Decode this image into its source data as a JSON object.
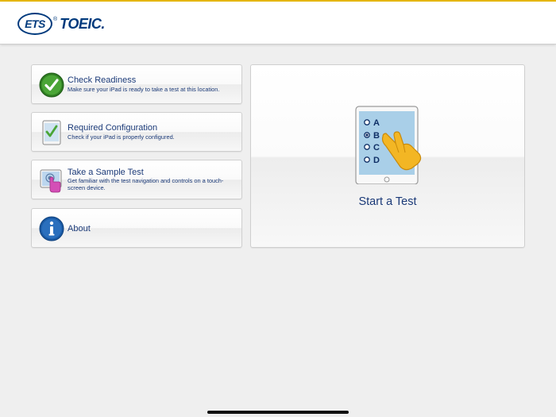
{
  "header": {
    "logo_ets": "ETS",
    "logo_reg": "®",
    "logo_product": "TOEIC."
  },
  "menu": [
    {
      "title": "Check Readiness",
      "subtitle": "Make sure your iPad is ready to take a test at this location.",
      "icon": "check-circle-icon"
    },
    {
      "title": "Required Configuration",
      "subtitle": "Check if your iPad is properly configured.",
      "icon": "ipad-check-icon"
    },
    {
      "title": "Take a Sample Test",
      "subtitle": "Get familiar with the test navigation and controls on a touch-screen device.",
      "icon": "touch-screen-icon"
    },
    {
      "title": "About",
      "subtitle": "",
      "icon": "info-icon"
    }
  ],
  "start": {
    "label": "Start a Test",
    "options": [
      "A",
      "B",
      "C",
      "D"
    ],
    "selected": "B"
  },
  "colors": {
    "brand_blue": "#003a7d",
    "text_blue": "#1b3a78",
    "accent_yellow": "#e8b800",
    "check_green": "#3f9b2f"
  }
}
